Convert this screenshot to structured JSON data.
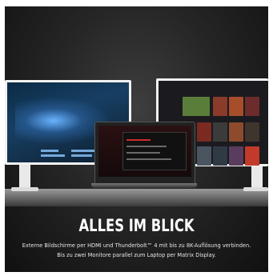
{
  "banner": {
    "headline": "ALLES IM BLICK",
    "line1": "Externe Bildschirme per HDMI und Thunderbolt™ 4 mit bis zu 8K-Auflösung verbinden.",
    "line2": "Bis zu zwei Monitore parallel zum Laptop per Matrix Display."
  },
  "colors": {
    "background": "#1e1e1e",
    "headline": "#ffffff",
    "body_text": "#e6e6e6",
    "accent_red": "#c9302c"
  }
}
